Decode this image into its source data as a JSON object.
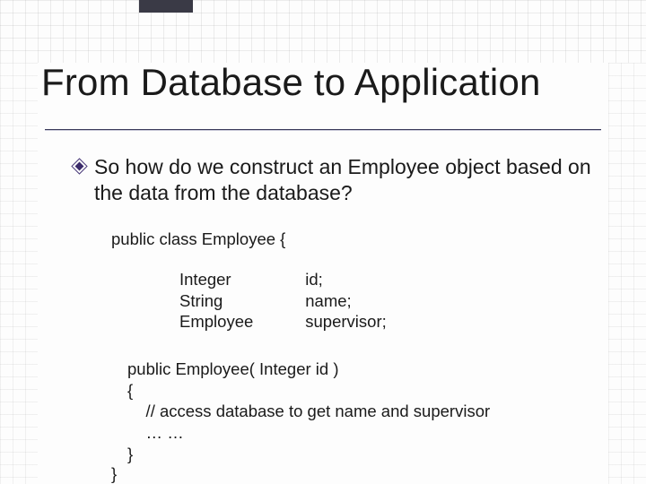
{
  "title": "From Database to Application",
  "bullet": "So how do we construct an Employee object based on the data from the database?",
  "code": {
    "decl": "public class Employee {",
    "fields": {
      "types": [
        "Integer",
        "String",
        "Employee"
      ],
      "names": [
        "id;",
        "name;",
        "supervisor;"
      ]
    },
    "ctor": {
      "sig": "public Employee( Integer id )",
      "open": "{",
      "comment": "    // access database to get name and supervisor",
      "ellipsis": "    … …",
      "close": "}"
    },
    "classClose": "}"
  }
}
